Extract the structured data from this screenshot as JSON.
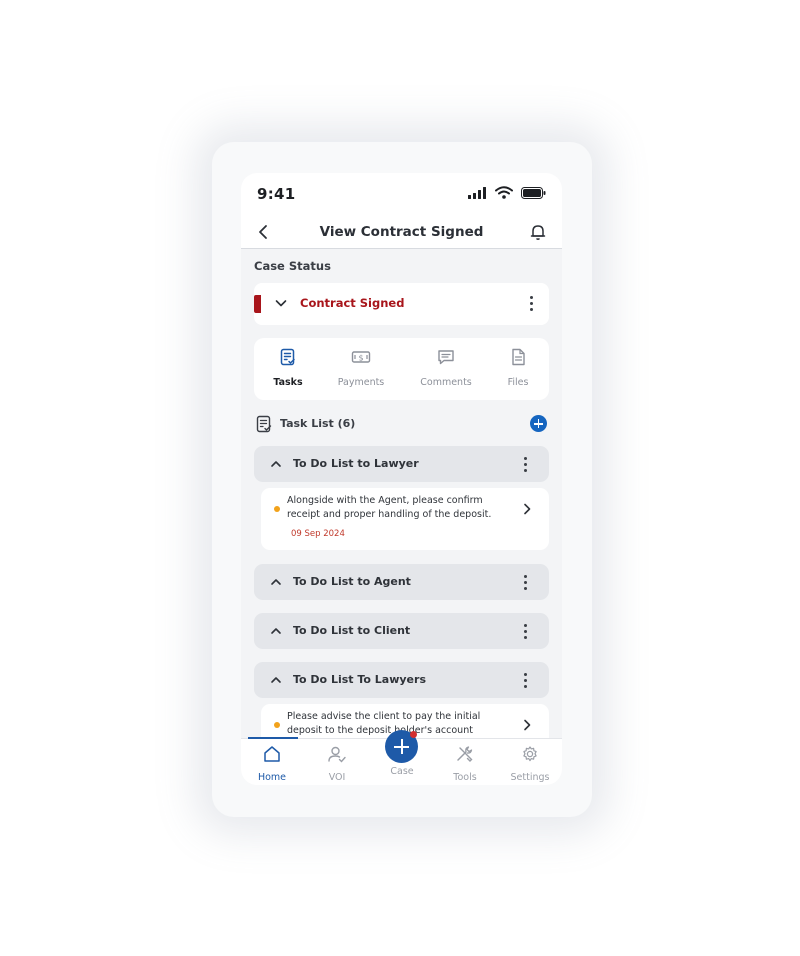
{
  "status_bar": {
    "time": "9:41"
  },
  "header": {
    "title": "View Contract Signed",
    "back_icon": "chevron-left-icon",
    "bell_icon": "bell-icon"
  },
  "case_status": {
    "label": "Case Status",
    "value": "Contract Signed",
    "accent": "#a8151b"
  },
  "tabs": [
    {
      "label": "Tasks",
      "icon": "tasks-icon",
      "active": true
    },
    {
      "label": "Payments",
      "icon": "payments-icon",
      "active": false
    },
    {
      "label": "Comments",
      "icon": "comments-icon",
      "active": false
    },
    {
      "label": "Files",
      "icon": "files-icon",
      "active": false
    }
  ],
  "task_list": {
    "title": "Task List (6)",
    "groups": [
      {
        "title": "To Do List to Lawyer",
        "expanded": true,
        "tasks": [
          {
            "text": "Alongside with the Agent, please confirm receipt and proper handling of the deposit.",
            "date": "09 Sep 2024"
          }
        ]
      },
      {
        "title": "To Do List to Agent",
        "expanded": false,
        "tasks": []
      },
      {
        "title": "To Do List to Client",
        "expanded": false,
        "tasks": []
      },
      {
        "title": "To Do List To Lawyers",
        "expanded": true,
        "tasks": [
          {
            "text": "Please advise the client to pay the initial deposit to the deposit holder's      account",
            "date": ""
          }
        ]
      }
    ]
  },
  "bottom_nav": [
    {
      "label": "Home",
      "icon": "home-icon",
      "active": true
    },
    {
      "label": "VOI",
      "icon": "user-check-icon",
      "active": false
    },
    {
      "label": "Case",
      "icon": "plus-icon",
      "active": false
    },
    {
      "label": "Tools",
      "icon": "tools-icon",
      "active": false
    },
    {
      "label": "Settings",
      "icon": "gear-icon",
      "active": false
    }
  ],
  "colors": {
    "primary": "#1e5aa8",
    "status_red": "#a8151b",
    "task_dot": "#f2a21b",
    "date_red": "#c0392b"
  }
}
